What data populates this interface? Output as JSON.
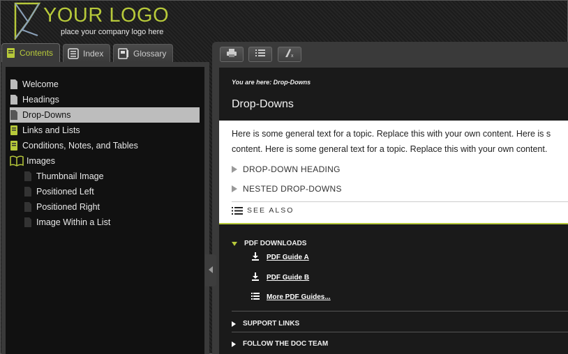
{
  "header": {
    "logo_title": "YOUR LOGO",
    "logo_tagline": "place your company logo here"
  },
  "tabs": [
    {
      "label": "Contents",
      "icon": "book-icon"
    },
    {
      "label": "Index",
      "icon": "list-icon"
    },
    {
      "label": "Glossary",
      "icon": "glossary-icon"
    }
  ],
  "toc": [
    {
      "label": "Welcome",
      "icon": "page-icon"
    },
    {
      "label": "Headings",
      "icon": "page-icon"
    },
    {
      "label": "Drop-Downs",
      "icon": "page-icon",
      "selected": true
    },
    {
      "label": "Links and Lists",
      "icon": "book-icon"
    },
    {
      "label": "Conditions, Notes, and Tables",
      "icon": "book-icon"
    },
    {
      "label": "Images",
      "icon": "open-book-icon"
    },
    {
      "label": "Thumbnail Image",
      "icon": "page-icon"
    },
    {
      "label": "Positioned Left",
      "icon": "page-icon"
    },
    {
      "label": "Positioned Right",
      "icon": "page-icon"
    },
    {
      "label": "Image Within a List",
      "icon": "page-icon"
    }
  ],
  "toolbar": {
    "print_icon": "print-icon",
    "toc_icon": "list-icon",
    "clear_highlight_icon": "clear-highlight-icon"
  },
  "content": {
    "breadcrumb": "You are here: Drop-Downs",
    "title": "Drop-Downs",
    "body_line1": "Here is some general text for a topic. Replace this with your own content. Here is s",
    "body_line2": "content. Here is some general text for a topic. Replace this with your own content.",
    "dropdown1": "DROP-DOWN HEADING",
    "dropdown2": "NESTED DROP-DOWNS",
    "see_also": "SEE ALSO"
  },
  "sections": {
    "pdf_downloads": "PDF DOWNLOADS",
    "pdf_guide_a": "PDF Guide A",
    "pdf_guide_b": "PDF Guide B",
    "more_pdf": "More PDF Guides...",
    "support_links": "SUPPORT LINKS",
    "follow_team": "FOLLOW THE DOC TEAM"
  },
  "colors": {
    "accent": "#b7c93a",
    "selected_bg": "#bdbdbd"
  }
}
